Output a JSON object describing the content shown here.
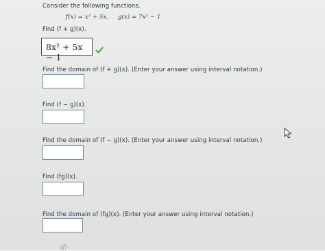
{
  "intro": "Consider the following functions.",
  "functions": {
    "f": "f(x) = x² + 5x,",
    "g": "g(x) = 7x² − 1"
  },
  "questions": [
    {
      "prompt": "Find  (f + g)(x).",
      "answer": "8x² + 5x − 1",
      "status": "correct"
    },
    {
      "prompt": "Find the domain of  (f + g)(x).  (Enter your answer using interval notation.)",
      "answer": ""
    },
    {
      "prompt": "Find  (f − g)(x).",
      "answer": ""
    },
    {
      "prompt": "Find the domain of  (f − g)(x).  (Enter your answer using interval notation.)",
      "answer": ""
    },
    {
      "prompt": "Find  (fg)(x).",
      "answer": ""
    },
    {
      "prompt": "Find the domain of  (fg)(x).  (Enter your answer using interval notation.)",
      "answer": ""
    }
  ],
  "partial_next": "(f)",
  "colors": {
    "check": "#3a9a3a",
    "field_border": "#6f8796"
  },
  "icons": {
    "check": "checkmark-icon",
    "cursor": "mouse-pointer-icon"
  }
}
